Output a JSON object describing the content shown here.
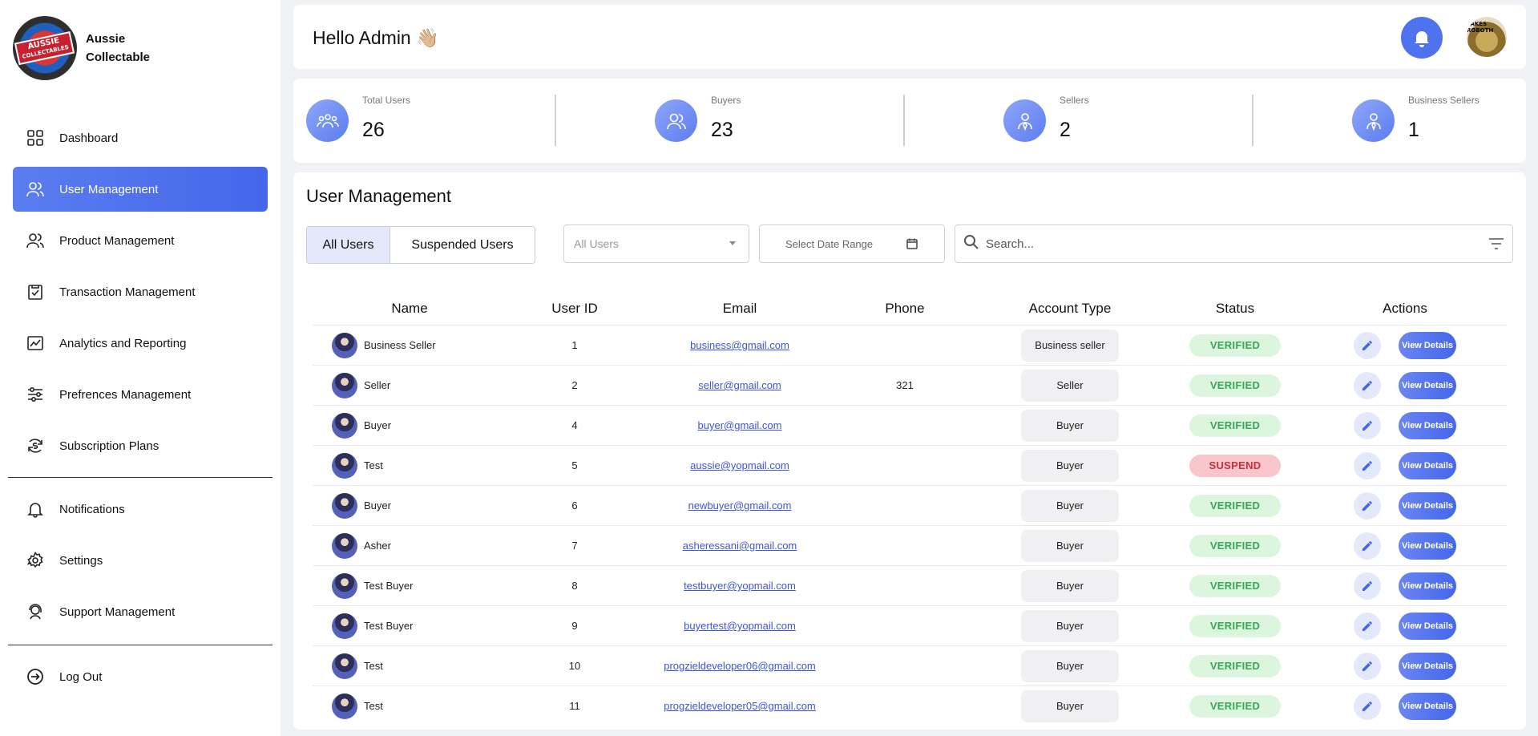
{
  "brand": {
    "name_line1": "Aussie",
    "name_line2": "Collectable",
    "logo_text_line1": "AUSSIE",
    "logo_text_line2": "COLLECTABLES"
  },
  "sidebar": {
    "items": [
      {
        "label": "Dashboard",
        "icon": "grid-icon"
      },
      {
        "label": "User Management",
        "icon": "users-icon",
        "active": true
      },
      {
        "label": "Product Management",
        "icon": "users-icon"
      },
      {
        "label": "Transaction Management",
        "icon": "clipboard-check-icon"
      },
      {
        "label": "Analytics and Reporting",
        "icon": "chart-icon"
      },
      {
        "label": "Prefrences Management",
        "icon": "sliders-icon"
      },
      {
        "label": "Subscription Plans",
        "icon": "dollar-cycle-icon"
      }
    ],
    "items2": [
      {
        "label": "Notifications",
        "icon": "bell-icon"
      },
      {
        "label": "Settings",
        "icon": "gear-icon"
      },
      {
        "label": "Support Management",
        "icon": "support-icon"
      }
    ],
    "logout": {
      "label": "Log Out",
      "icon": "logout-icon"
    }
  },
  "header": {
    "greeting": "Hello Admin 👋🏼",
    "avatar_text": "LAKES ROBOTH"
  },
  "stats": [
    {
      "label": "Total Users",
      "value": "26",
      "icon": "group-icon"
    },
    {
      "label": "Buyers",
      "value": "23",
      "icon": "buyers-icon"
    },
    {
      "label": "Sellers",
      "value": "2",
      "icon": "seller-icon"
    },
    {
      "label": "Business Sellers",
      "value": "1",
      "icon": "seller-icon"
    }
  ],
  "main": {
    "title": "User Management",
    "tabs": [
      "All Users",
      "Suspended Users"
    ],
    "filter_select": "All Users",
    "date_placeholder": "Select Date Range",
    "search_placeholder": "Search..."
  },
  "table": {
    "headers": [
      "Name",
      "User ID",
      "Email",
      "Phone",
      "Account Type",
      "Status",
      "Actions"
    ],
    "view_label": "View Details",
    "rows": [
      {
        "name": "Business Seller",
        "id": "1",
        "email": "business@gmail.com",
        "phone": "",
        "type": "Business seller",
        "status": "VERIFIED"
      },
      {
        "name": "Seller",
        "id": "2",
        "email": "seller@gmail.com",
        "phone": "321",
        "type": "Seller",
        "status": "VERIFIED"
      },
      {
        "name": "Buyer",
        "id": "4",
        "email": "buyer@gmail.com",
        "phone": "",
        "type": "Buyer",
        "status": "VERIFIED"
      },
      {
        "name": "Test",
        "id": "5",
        "email": "aussie@yopmail.com",
        "phone": "",
        "type": "Buyer",
        "status": "SUSPEND"
      },
      {
        "name": "Buyer",
        "id": "6",
        "email": "newbuyer@gmail.com",
        "phone": "",
        "type": "Buyer",
        "status": "VERIFIED"
      },
      {
        "name": "Asher",
        "id": "7",
        "email": "asheressani@gmail.com",
        "phone": "",
        "type": "Buyer",
        "status": "VERIFIED"
      },
      {
        "name": "Test Buyer",
        "id": "8",
        "email": "testbuyer@yopmail.com",
        "phone": "",
        "type": "Buyer",
        "status": "VERIFIED"
      },
      {
        "name": "Test Buyer",
        "id": "9",
        "email": "buyertest@yopmail.com",
        "phone": "",
        "type": "Buyer",
        "status": "VERIFIED"
      },
      {
        "name": "Test",
        "id": "10",
        "email": "progzieldeveloper06@gmail.com",
        "phone": "",
        "type": "Buyer",
        "status": "VERIFIED"
      },
      {
        "name": "Test",
        "id": "11",
        "email": "progzieldeveloper05@gmail.com",
        "phone": "",
        "type": "Buyer",
        "status": "VERIFIED"
      }
    ]
  },
  "colors": {
    "accent": "#4466ea",
    "verified_bg": "#dcf5dd",
    "verified_text": "#3aa65a",
    "suspend_bg": "#f9c6cb",
    "suspend_text": "#c7313f"
  }
}
